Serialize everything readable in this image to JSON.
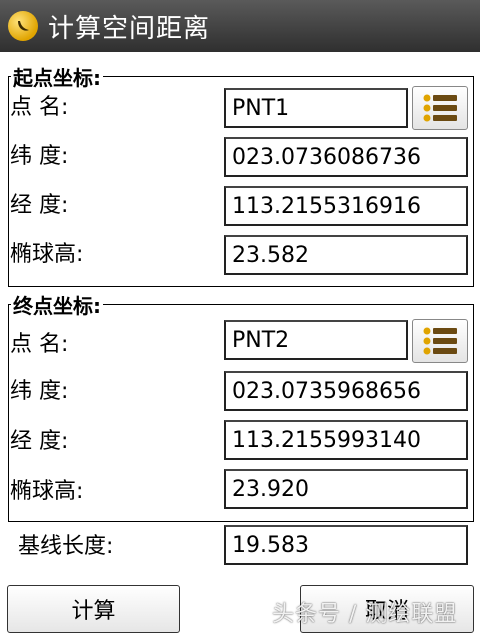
{
  "window": {
    "title": "计算空间距离",
    "logo_icon": "app-logo-icon",
    "titlebar_color": "#3f3f3f"
  },
  "start_point": {
    "legend": "起点坐标:",
    "name_label": "点 名:",
    "name_value": "PNT1",
    "lat_label": "纬 度:",
    "lat_value": "023.0736086736",
    "lon_label": "经 度:",
    "lon_value": "113.2155316916",
    "height_label": "椭球高:",
    "height_value": "23.582",
    "list_icon": "list-icon"
  },
  "end_point": {
    "legend": "终点坐标:",
    "name_label": "点 名:",
    "name_value": "PNT2",
    "lat_label": "纬 度:",
    "lat_value": "023.0735968656",
    "lon_label": "经 度:",
    "lon_value": "113.2155993140",
    "height_label": "椭球高:",
    "height_value": "23.920",
    "list_icon": "list-icon"
  },
  "baseline": {
    "label": "基线长度:",
    "value": "19.583"
  },
  "buttons": {
    "calculate": "计算",
    "cancel": "取消"
  },
  "watermark": "头条号 / 测绘联盟",
  "colors": {
    "icon_gold": "#e0a400",
    "icon_brown": "#6b4a12"
  }
}
